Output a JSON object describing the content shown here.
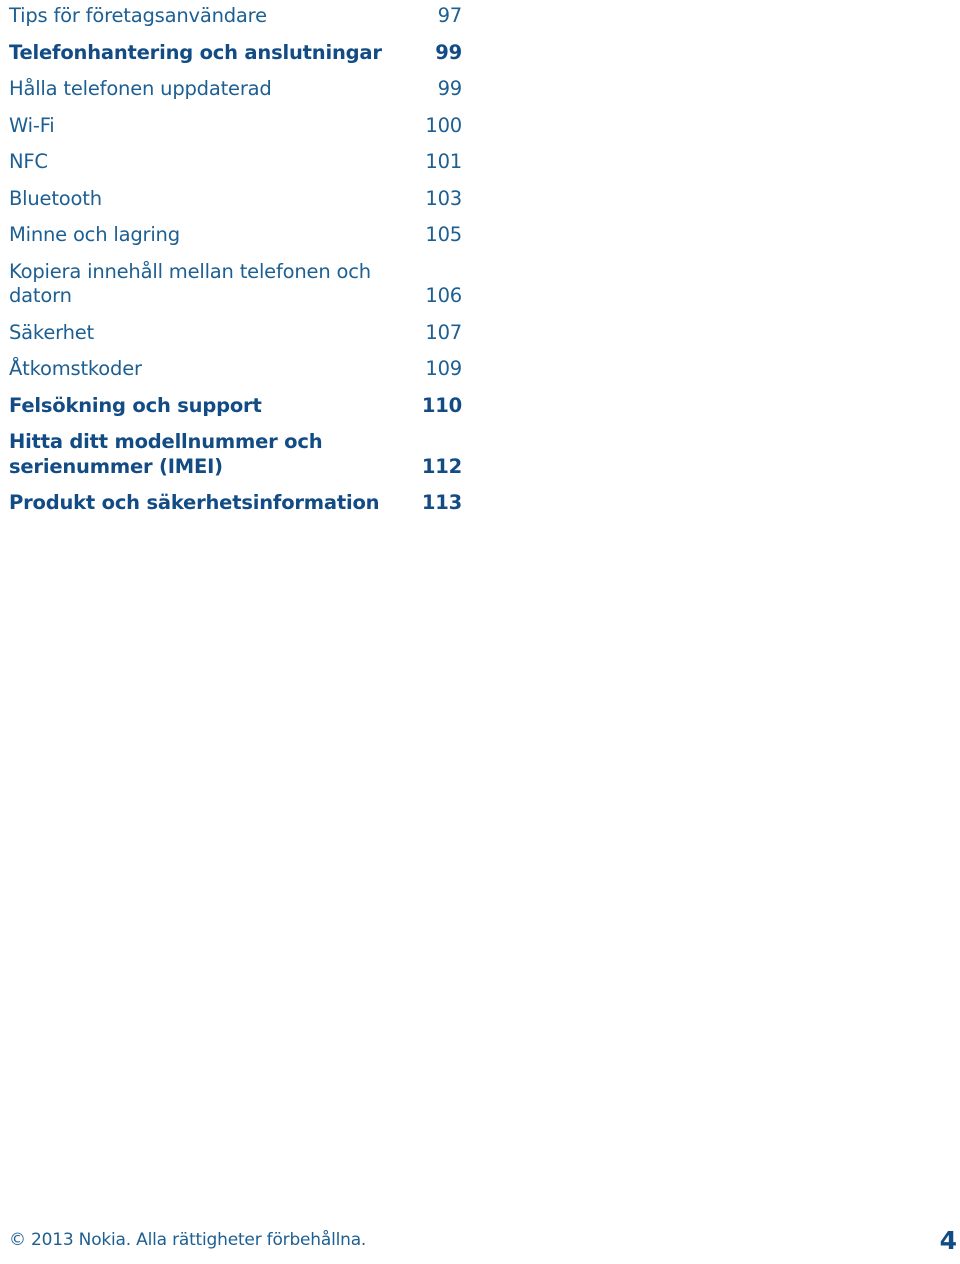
{
  "toc": {
    "entries": [
      {
        "title": "Tips för företagsanvändare",
        "page": "97",
        "bold": false
      },
      {
        "title": "Telefonhantering och anslutningar",
        "page": "99",
        "bold": true
      },
      {
        "title": "Hålla telefonen uppdaterad",
        "page": "99",
        "bold": false
      },
      {
        "title": "Wi-Fi",
        "page": "100",
        "bold": false
      },
      {
        "title": "NFC",
        "page": "101",
        "bold": false
      },
      {
        "title": "Bluetooth",
        "page": "103",
        "bold": false
      },
      {
        "title": "Minne och lagring",
        "page": "105",
        "bold": false
      },
      {
        "title": "Kopiera innehåll mellan telefonen och datorn",
        "page": "106",
        "bold": false
      },
      {
        "title": "Säkerhet",
        "page": "107",
        "bold": false
      },
      {
        "title": "Åtkomstkoder",
        "page": "109",
        "bold": false
      },
      {
        "title": "Felsökning och support",
        "page": "110",
        "bold": true
      },
      {
        "title": "Hitta ditt modellnummer och serienummer (IMEI)",
        "page": "112",
        "bold": true
      },
      {
        "title": "Produkt och säkerhetsinformation",
        "page": "113",
        "bold": true
      }
    ]
  },
  "footer": {
    "copyright": "© 2013 Nokia. Alla rättigheter förbehållna.",
    "page_number": "4"
  },
  "colors": {
    "text": "#1d5f92",
    "heading": "#134c85",
    "background": "#ffffff"
  }
}
